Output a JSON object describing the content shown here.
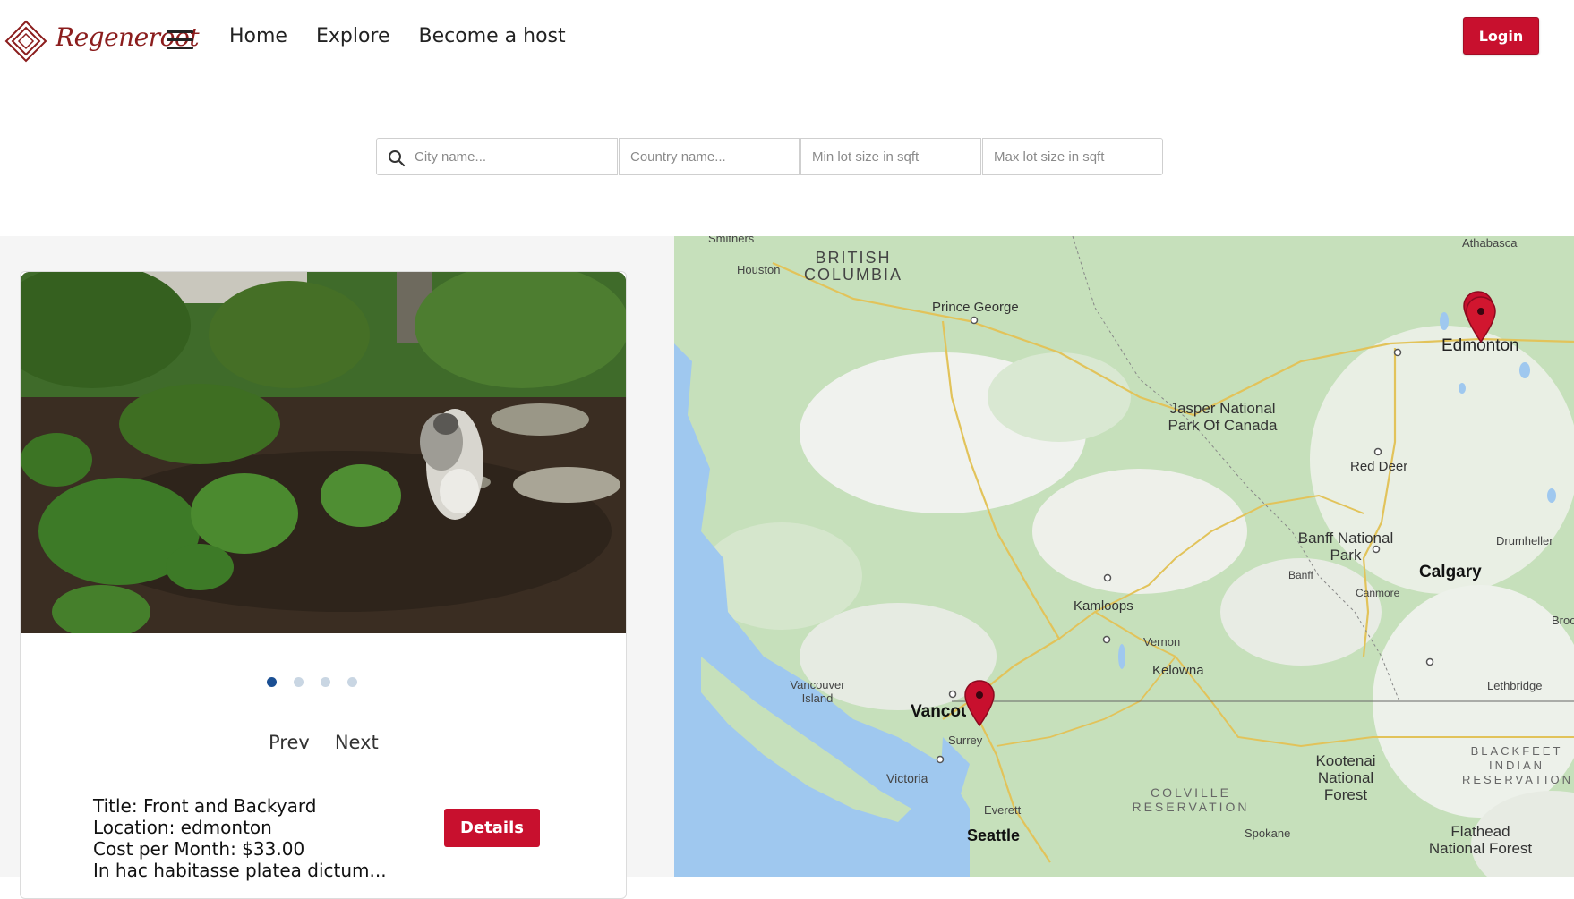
{
  "header": {
    "logo_text": "Regeneroot",
    "nav": {
      "home": "Home",
      "explore": "Explore",
      "become_host": "Become a host"
    },
    "login_label": "Login"
  },
  "search": {
    "city_placeholder": "City name...",
    "country_placeholder": "Country name...",
    "min_lot_placeholder": "Min lot size in sqft",
    "max_lot_placeholder": "Max lot size in sqft"
  },
  "listing": {
    "carousel_dots": 4,
    "active_dot": 0,
    "prev_label": "Prev",
    "next_label": "Next",
    "title": "Title: Front and Backyard",
    "location": "Location: edmonton",
    "cost": "Cost per Month: $33.00",
    "description": "In hac habitasse platea dictum...",
    "details_label": "Details"
  },
  "map": {
    "labels": {
      "smithers": "Smithers",
      "houston": "Houston",
      "british_columbia": "BRITISH COLUMBIA",
      "prince_george": "Prince George",
      "athabasca": "Athabasca",
      "edmonton": "Edmonton",
      "jasper": "Jasper National Park Of Canada",
      "red_deer": "Red Deer",
      "drumheller": "Drumheller",
      "banff_park": "Banff National Park",
      "banff": "Banff",
      "canmore": "Canmore",
      "calgary": "Calgary",
      "brooks": "Broo",
      "kamloops": "Kamloops",
      "vernon": "Vernon",
      "kelowna": "Kelowna",
      "lethbridge": "Lethbridge",
      "vancouver_island": "Vancouver Island",
      "vancouver": "Vancouver",
      "surrey": "Surrey",
      "victoria": "Victoria",
      "everett": "Everett",
      "seattle": "Seattle",
      "spokane": "Spokane",
      "kootenai": "Kootenai National Forest",
      "colville": "COLVILLE RESERVATION",
      "blackfeet": "BLACKFEET INDIAN RESERVATION",
      "flathead": "Flathead National Forest"
    }
  },
  "colors": {
    "brand_red": "#c8102e",
    "active_dot": "#1a4f93",
    "logo": "#8b1d1d"
  }
}
